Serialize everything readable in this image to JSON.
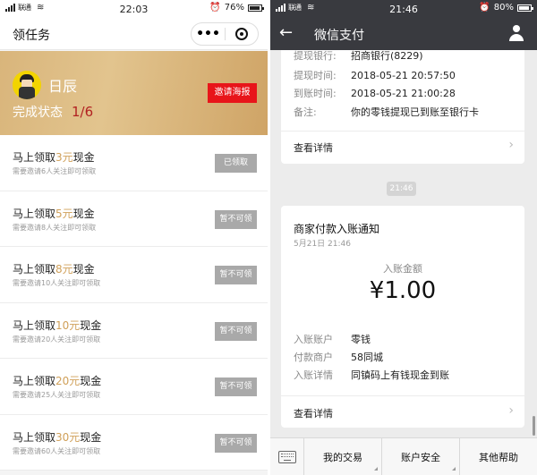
{
  "left": {
    "status": {
      "carrier": "联通",
      "time": "22:03",
      "battery": "76%",
      "battery_level": 0.76
    },
    "nav": {
      "title": "领任务"
    },
    "banner": {
      "username": "日辰",
      "progress_label": "完成状态",
      "progress_value": "1/6",
      "invite_button": "邀请海报"
    },
    "tasks": [
      {
        "prefix": "马上领取",
        "amount": "3元",
        "suffix": "现金",
        "sub": "需要邀请6人关注即可领取",
        "button": "已领取"
      },
      {
        "prefix": "马上领取",
        "amount": "5元",
        "suffix": "现金",
        "sub": "需要邀请8人关注即可领取",
        "button": "暂不可领"
      },
      {
        "prefix": "马上领取",
        "amount": "8元",
        "suffix": "现金",
        "sub": "需要邀请10人关注即可领取",
        "button": "暂不可领"
      },
      {
        "prefix": "马上领取",
        "amount": "10元",
        "suffix": "现金",
        "sub": "需要邀请20人关注即可领取",
        "button": "暂不可领"
      },
      {
        "prefix": "马上领取",
        "amount": "20元",
        "suffix": "现金",
        "sub": "需要邀请25人关注即可领取",
        "button": "暂不可领"
      },
      {
        "prefix": "马上领取",
        "amount": "30元",
        "suffix": "现金",
        "sub": "需要邀请60人关注即可领取",
        "button": "暂不可领"
      }
    ]
  },
  "right": {
    "status": {
      "carrier": "联通",
      "time": "21:46",
      "battery": "80%",
      "battery_level": 0.8
    },
    "nav": {
      "title": "微信支付"
    },
    "card1": {
      "rows": [
        {
          "key": "提现银行:",
          "value": "招商银行(8229)"
        },
        {
          "key": "提现时间:",
          "value": "2018-05-21 20:57:50"
        },
        {
          "key": "到账时间:",
          "value": "2018-05-21 21:00:28"
        },
        {
          "key": "备注:",
          "value": "你的零钱提现已到账至银行卡"
        }
      ],
      "detail_link": "查看详情"
    },
    "time_pill": "21:46",
    "card2": {
      "title": "商家付款入账通知",
      "date": "5月21日  21:46",
      "amount_label": "入账金额",
      "amount": "¥1.00",
      "rows": [
        {
          "key": "入账账户",
          "value": "零钱"
        },
        {
          "key": "付款商户",
          "value": "58同城"
        },
        {
          "key": "入账详情",
          "value": "同镇码上有钱现金到账"
        }
      ],
      "detail_link": "查看详情"
    },
    "bottom_menu": [
      "我的交易",
      "账户安全",
      "其他帮助"
    ]
  },
  "colors": {
    "gold": "#d0a059",
    "invite_red": "#e8151a",
    "dark_bar": "#393a3f"
  }
}
